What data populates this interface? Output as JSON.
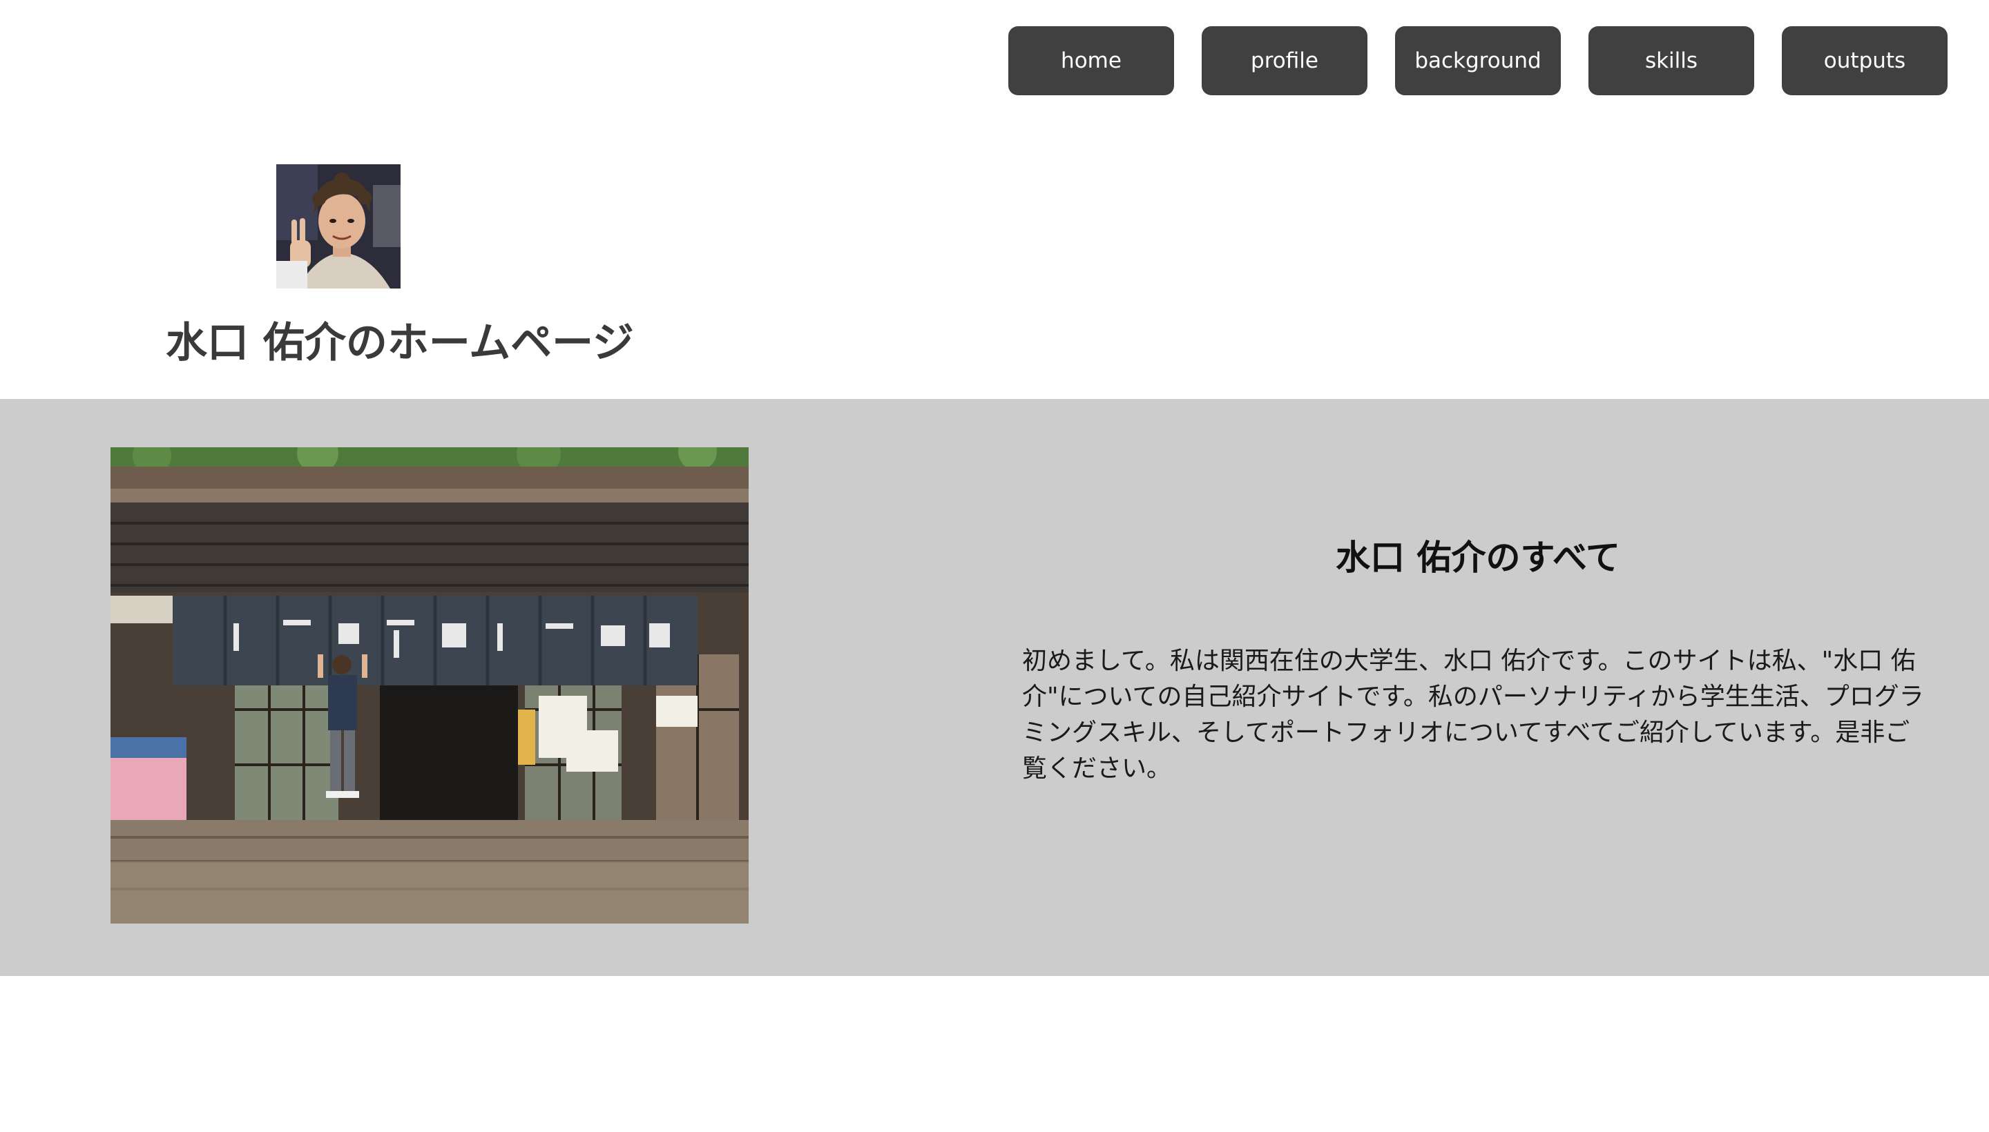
{
  "nav": {
    "items": [
      {
        "label": "home"
      },
      {
        "label": "profile"
      },
      {
        "label": "background"
      },
      {
        "label": "skills"
      },
      {
        "label": "outputs"
      }
    ]
  },
  "header": {
    "title": "水口 佑介のホームページ"
  },
  "main": {
    "heading": "水口 佑介のすべて",
    "text": "初めまして。私は関西在住の大学生、水口 佑介です。このサイトは私、\"水口 佑介\"についての自己紹介サイトです。私のパーソナリティから学生生活、プログラミングスキル、そしてポートフォリオについてすべてご紹介しています。是非ご覧ください。"
  },
  "colors": {
    "nav_button_bg": "#404040",
    "band_bg": "#cccccc",
    "title_text": "#3a3a3a"
  }
}
